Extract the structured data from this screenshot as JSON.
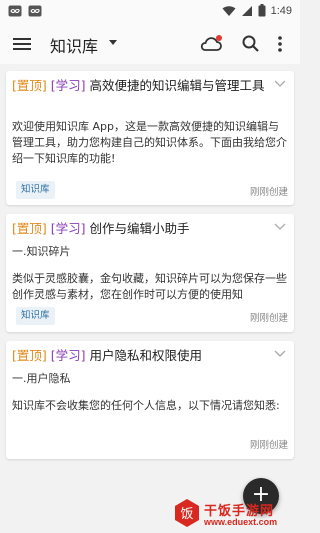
{
  "status_bar": {
    "time": "1:49",
    "icons": [
      "infinity-icon",
      "infinity-icon",
      "wifi-icon",
      "cellular-icon",
      "battery-icon"
    ]
  },
  "app_bar": {
    "title": "知识库",
    "icons": [
      "menu-icon",
      "caret-down-icon",
      "cloud-sync-icon",
      "search-icon",
      "more-vert-icon"
    ],
    "sync_dot_color": "#e53935"
  },
  "colors": {
    "tag_pinned": "#e08a1a",
    "tag_category": "#8a3fb8",
    "chip_bg": "#eaf2f8",
    "chip_text": "#2c6fa0",
    "fab_bg": "#2a2a2a",
    "watermark": "#d9281f"
  },
  "notes": [
    {
      "tag_pinned": "[置顶]",
      "tag_category": "[学习]",
      "title": "高效便捷的知识编辑与管理工具",
      "subheading": "",
      "body": "欢迎使用知识库 App，这是一款高效便捷的知识编辑与管理工具，助力您构建自己的知识体系。下面由我给您介绍一下知识库的功能!",
      "chip": "知识库",
      "time": "刚刚创建"
    },
    {
      "tag_pinned": "[置顶]",
      "tag_category": "[学习]",
      "title": "创作与编辑小助手",
      "subheading": "一.知识碎片",
      "body": "类似于灵感胶囊，金句收藏，知识碎片可以为您保存一些创作灵感与素材，您在创作时可以方便的使用知",
      "chip": "知识库",
      "time": "刚刚创建"
    },
    {
      "tag_pinned": "[置顶]",
      "tag_category": "[学习]",
      "title": "用户隐私和权限使用",
      "subheading": "一.用户隐私",
      "body": "知识库不会收集您的任何个人信息，以下情况请您知悉:",
      "chip": "",
      "time": "刚刚创建"
    }
  ],
  "fab": {
    "label": "+"
  },
  "watermark": {
    "title": "干饭手游网",
    "url": "www.eduext.com",
    "badge_char": "饭"
  }
}
